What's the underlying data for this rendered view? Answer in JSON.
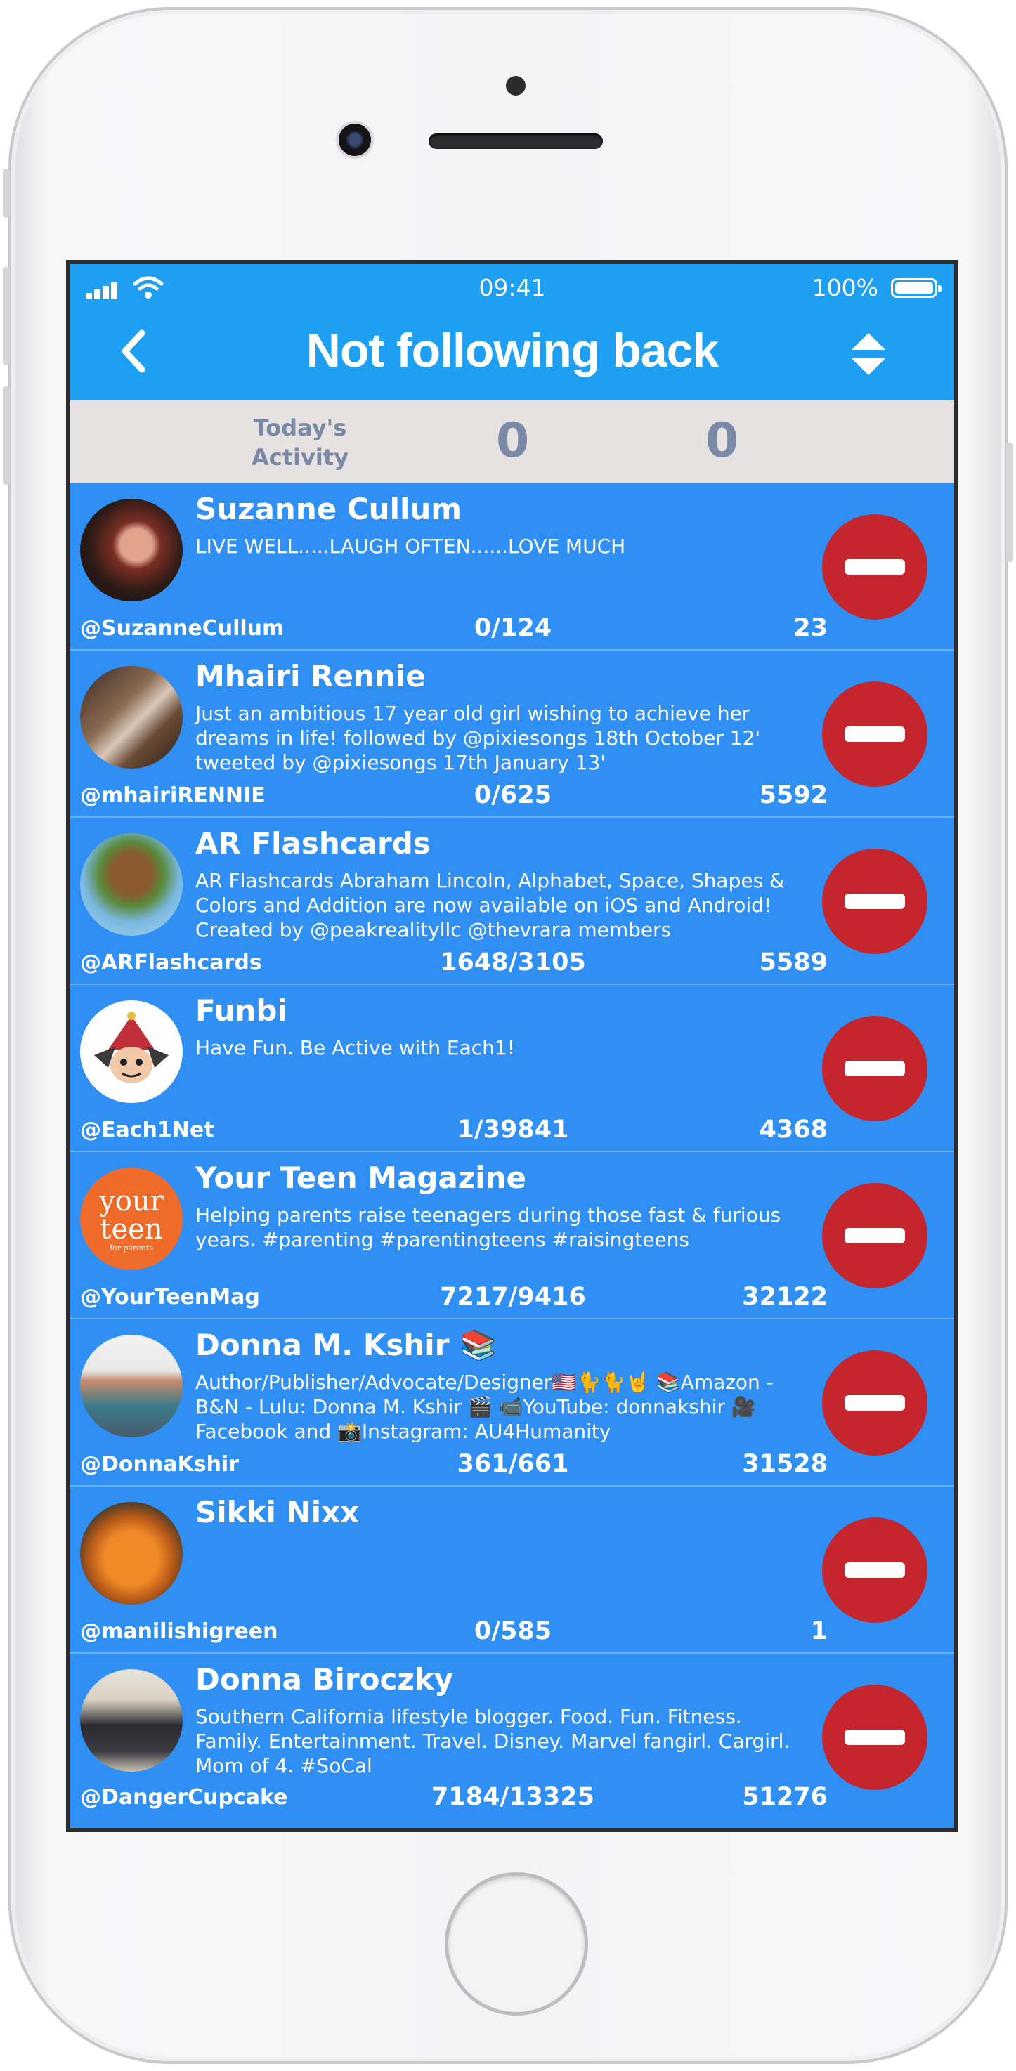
{
  "status_bar": {
    "time": "09:41",
    "battery": "100%"
  },
  "nav": {
    "title": "Not following back",
    "back_icon": "chevron-left-icon",
    "sort_icon": "sort-icon"
  },
  "activity": {
    "label_line1": "Today's",
    "label_line2": "Activity",
    "value1": "0",
    "value2": "0"
  },
  "colors": {
    "header": "#1e9ff1",
    "row": "#2f8ff2",
    "unfollow": "#c5252d",
    "activity_bg": "#e6e2e1",
    "activity_text": "#7a8aa6"
  },
  "users": [
    {
      "name": "Suzanne Cullum",
      "bio": "LIVE WELL.....LAUGH OFTEN......LOVE MUCH",
      "handle": "@SuzanneCullum",
      "ratio": "0/124",
      "count": "23"
    },
    {
      "name": "Mhairi Rennie",
      "bio": "Just an ambitious 17 year old girl wishing to achieve her dreams in life! followed by @pixiesongs 18th October 12' tweeted by @pixiesongs 17th January 13'",
      "handle": "@mhairiRENNIE",
      "ratio": "0/625",
      "count": "5592"
    },
    {
      "name": "AR Flashcards",
      "bio": "AR Flashcards Abraham Lincoln, Alphabet, Space, Shapes & Colors and Addition are now available on iOS and Android! Created by @peakrealityllc @thevrara members",
      "handle": "@ARFlashcards",
      "ratio": "1648/3105",
      "count": "5589"
    },
    {
      "name": "Funbi",
      "bio": "Have Fun. Be Active with Each1!",
      "handle": "@Each1Net",
      "ratio": "1/39841",
      "count": "4368"
    },
    {
      "name": "Your Teen Magazine",
      "bio": "Helping parents raise teenagers during those fast & furious years. #parenting #parentingteens #raisingteens",
      "handle": "@YourTeenMag",
      "ratio": "7217/9416",
      "count": "32122"
    },
    {
      "name": "Donna M. Kshir 📚",
      "bio": "Author/Publisher/Advocate/Designer🇺🇸🐈🐈🤘 📚Amazon - B&N - Lulu: Donna M. Kshir 🎬 📹YouTube: donnakshir 🎥 Facebook and 📸Instagram: AU4Humanity",
      "handle": "@DonnaKshir",
      "ratio": "361/661",
      "count": "31528"
    },
    {
      "name": "Sikki Nixx",
      "bio": "",
      "handle": "@manilishigreen",
      "ratio": "0/585",
      "count": "1"
    },
    {
      "name": "Donna Biroczky",
      "bio": "Southern California lifestyle blogger. Food. Fun. Fitness. Family. Entertainment. Travel. Disney. Marvel fangirl. Cargirl. Mom of 4. #SoCal",
      "handle": "@DangerCupcake",
      "ratio": "7184/13325",
      "count": "51276"
    }
  ],
  "avatar_logo_text": {
    "line1": "your",
    "line2": "teen",
    "line3": "for parents"
  }
}
